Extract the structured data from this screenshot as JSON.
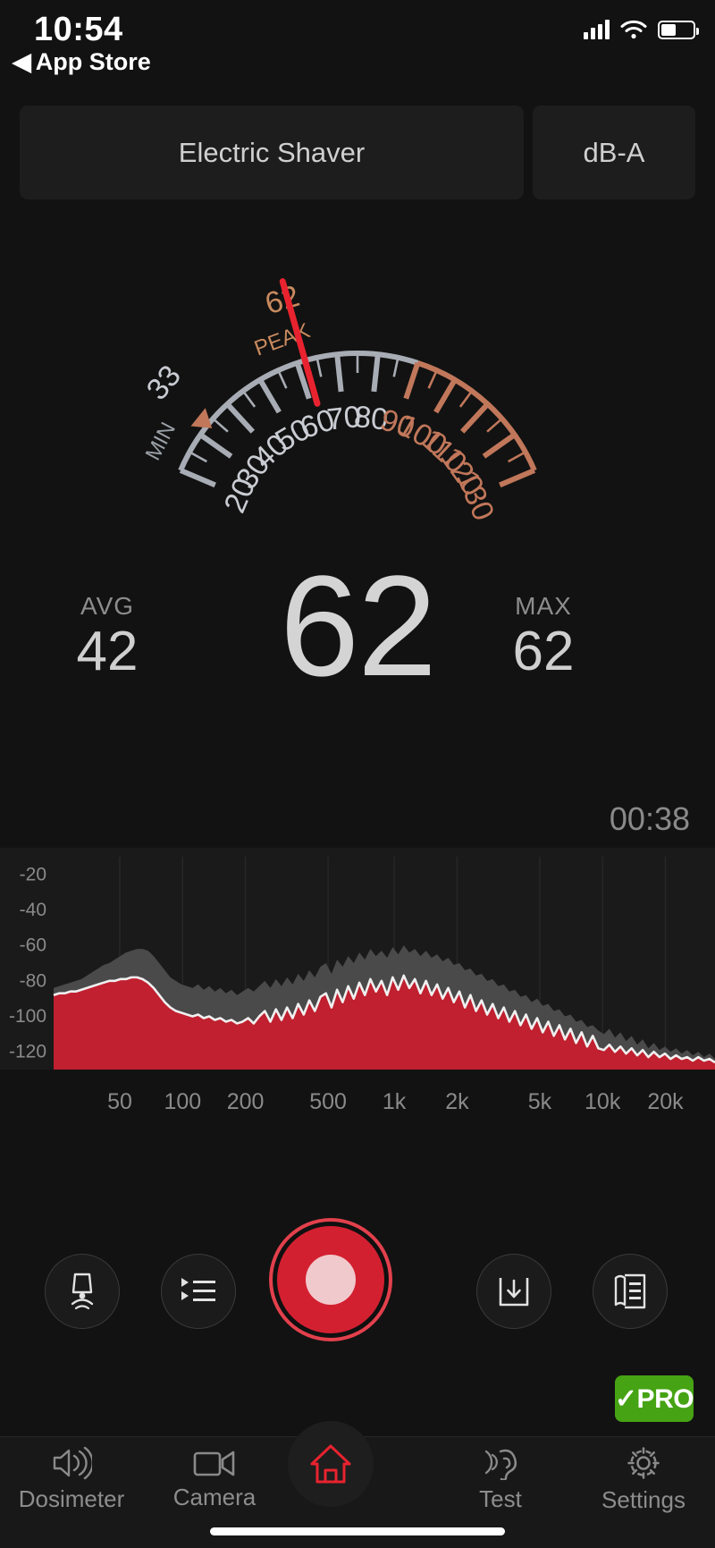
{
  "status_bar": {
    "time": "10:54",
    "back_label": "App Store",
    "back_icon": "triangle-left-icon",
    "signal_icon": "cellular-bars-icon",
    "wifi_icon": "wifi-icon",
    "battery_icon": "battery-icon"
  },
  "header": {
    "preset_label": "Electric Shaver",
    "unit_label": "dB-A"
  },
  "gauge": {
    "min_marker_label": "MIN",
    "min_value": "33",
    "peak_marker_label": "PEAK",
    "peak_value": "62",
    "ticks": [
      "20",
      "30",
      "40",
      "50",
      "60",
      "70",
      "80",
      "90",
      "100",
      "110",
      "120",
      "130"
    ],
    "scale_min": 20,
    "scale_max": 130,
    "needle_value": 62,
    "warn_threshold": 90,
    "colors": {
      "normal": "#a8acb4",
      "warn": "#c1775a",
      "needle": "#e8232f",
      "peak_text": "#c98a5e"
    }
  },
  "readouts": {
    "avg_label": "AVG",
    "avg_value": "42",
    "current_value": "62",
    "max_label": "MAX",
    "max_value": "62"
  },
  "timer": {
    "elapsed": "00:38"
  },
  "chart_data": {
    "type": "area",
    "title": "",
    "xlabel": "",
    "ylabel": "",
    "ylim": [
      -130,
      -10
    ],
    "xtick_labels": [
      "50",
      "100",
      "200",
      "500",
      "1k",
      "2k",
      "5k",
      "10k",
      "20k"
    ],
    "xtick_positions": [
      0.1,
      0.195,
      0.29,
      0.415,
      0.515,
      0.61,
      0.735,
      0.83,
      0.925
    ],
    "ytick_labels": [
      "-20",
      "-40",
      "-60",
      "-80",
      "-100",
      "-120"
    ],
    "ytick_values": [
      -20,
      -40,
      -60,
      -80,
      -100,
      -120
    ],
    "grid": true,
    "series": [
      {
        "name": "peak-hold",
        "color": "#4a4a4a",
        "values": [
          -84,
          -83,
          -82,
          -81,
          -80,
          -79,
          -77,
          -75,
          -73,
          -71,
          -70,
          -68,
          -66,
          -64,
          -63,
          -62,
          -62,
          -63,
          -66,
          -70,
          -74,
          -78,
          -80,
          -82,
          -83,
          -84,
          -82,
          -85,
          -83,
          -86,
          -84,
          -87,
          -85,
          -88,
          -86,
          -84,
          -86,
          -83,
          -80,
          -84,
          -79,
          -83,
          -78,
          -82,
          -76,
          -80,
          -74,
          -78,
          -72,
          -70,
          -76,
          -68,
          -72,
          -66,
          -70,
          -64,
          -68,
          -62,
          -66,
          -63,
          -67,
          -61,
          -65,
          -60,
          -64,
          -62,
          -66,
          -63,
          -67,
          -65,
          -69,
          -67,
          -71,
          -70,
          -74,
          -73,
          -77,
          -76,
          -80,
          -79,
          -83,
          -82,
          -86,
          -85,
          -89,
          -88,
          -92,
          -90,
          -94,
          -93,
          -97,
          -96,
          -100,
          -99,
          -103,
          -102,
          -106,
          -105,
          -108,
          -110,
          -107,
          -112,
          -109,
          -114,
          -111,
          -116,
          -113,
          -118,
          -115,
          -119,
          -117,
          -120,
          -118,
          -121,
          -119,
          -122,
          -120,
          -123,
          -121,
          -124
        ]
      },
      {
        "name": "live-spectrum",
        "color": "#c0202f",
        "line_color": "#f0f0f0",
        "values": [
          -88,
          -87,
          -87,
          -86,
          -86,
          -85,
          -84,
          -83,
          -82,
          -81,
          -80,
          -80,
          -79,
          -79,
          -78,
          -78,
          -79,
          -81,
          -84,
          -88,
          -92,
          -95,
          -97,
          -98,
          -99,
          -100,
          -99,
          -101,
          -100,
          -102,
          -101,
          -103,
          -102,
          -104,
          -103,
          -101,
          -104,
          -100,
          -97,
          -103,
          -96,
          -102,
          -95,
          -101,
          -93,
          -99,
          -91,
          -97,
          -89,
          -87,
          -95,
          -85,
          -92,
          -83,
          -90,
          -81,
          -88,
          -79,
          -86,
          -80,
          -88,
          -78,
          -85,
          -77,
          -84,
          -79,
          -87,
          -80,
          -88,
          -82,
          -90,
          -84,
          -92,
          -86,
          -95,
          -88,
          -97,
          -91,
          -99,
          -93,
          -101,
          -95,
          -103,
          -97,
          -105,
          -99,
          -107,
          -101,
          -109,
          -103,
          -111,
          -105,
          -113,
          -107,
          -115,
          -109,
          -117,
          -111,
          -118,
          -119,
          -116,
          -120,
          -117,
          -121,
          -118,
          -122,
          -119,
          -123,
          -120,
          -123,
          -121,
          -124,
          -122,
          -124,
          -123,
          -125,
          -123,
          -125,
          -124,
          -126
        ]
      }
    ]
  },
  "controls": {
    "buttons": [
      {
        "name": "calibrate-button",
        "icon": "microphone-calibration-icon",
        "label": ""
      },
      {
        "name": "presets-list-button",
        "icon": "list-icon",
        "label": ""
      },
      {
        "name": "record-button",
        "icon": "record-circle-icon",
        "label": ""
      },
      {
        "name": "save-button",
        "icon": "download-inbox-icon",
        "label": ""
      },
      {
        "name": "report-button",
        "icon": "report-document-icon",
        "label": ""
      }
    ]
  },
  "pro_badge": {
    "label": "✓PRO",
    "color": "#46a314"
  },
  "tabbar": {
    "items": [
      {
        "label": "Dosimeter",
        "icon": "speaker-waves-icon",
        "active": false
      },
      {
        "label": "Camera",
        "icon": "video-camera-icon",
        "active": false
      },
      {
        "label": "",
        "icon": "home-icon",
        "active": true
      },
      {
        "label": "Test",
        "icon": "ear-hearing-icon",
        "active": false
      },
      {
        "label": "Settings",
        "icon": "gear-icon",
        "active": false
      }
    ],
    "active_color": "#e8232f"
  }
}
